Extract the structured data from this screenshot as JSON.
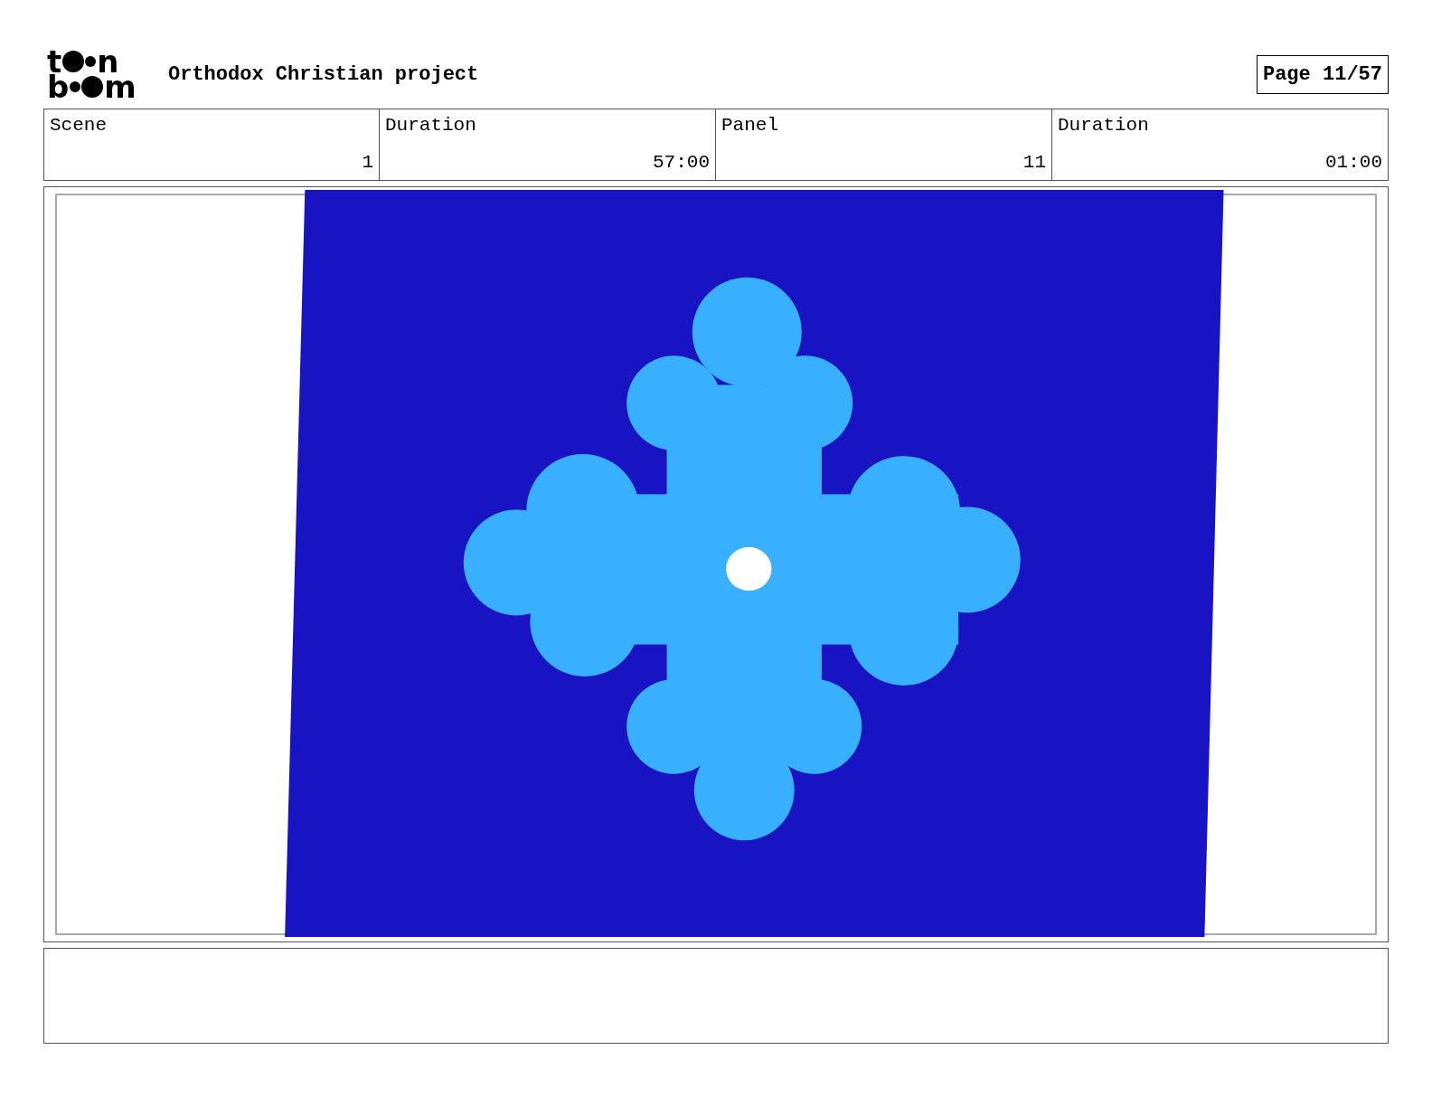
{
  "logo": {
    "top_letters": [
      "t",
      "n"
    ],
    "bottom_letters": [
      "b",
      "m"
    ]
  },
  "project_title": "Orthodox Christian project",
  "page_label": "Page 11/57",
  "header_labels": [
    "Scene",
    "Duration",
    "Panel",
    "Duration"
  ],
  "header_values": [
    "1",
    "57:00",
    "11",
    "01:00"
  ]
}
